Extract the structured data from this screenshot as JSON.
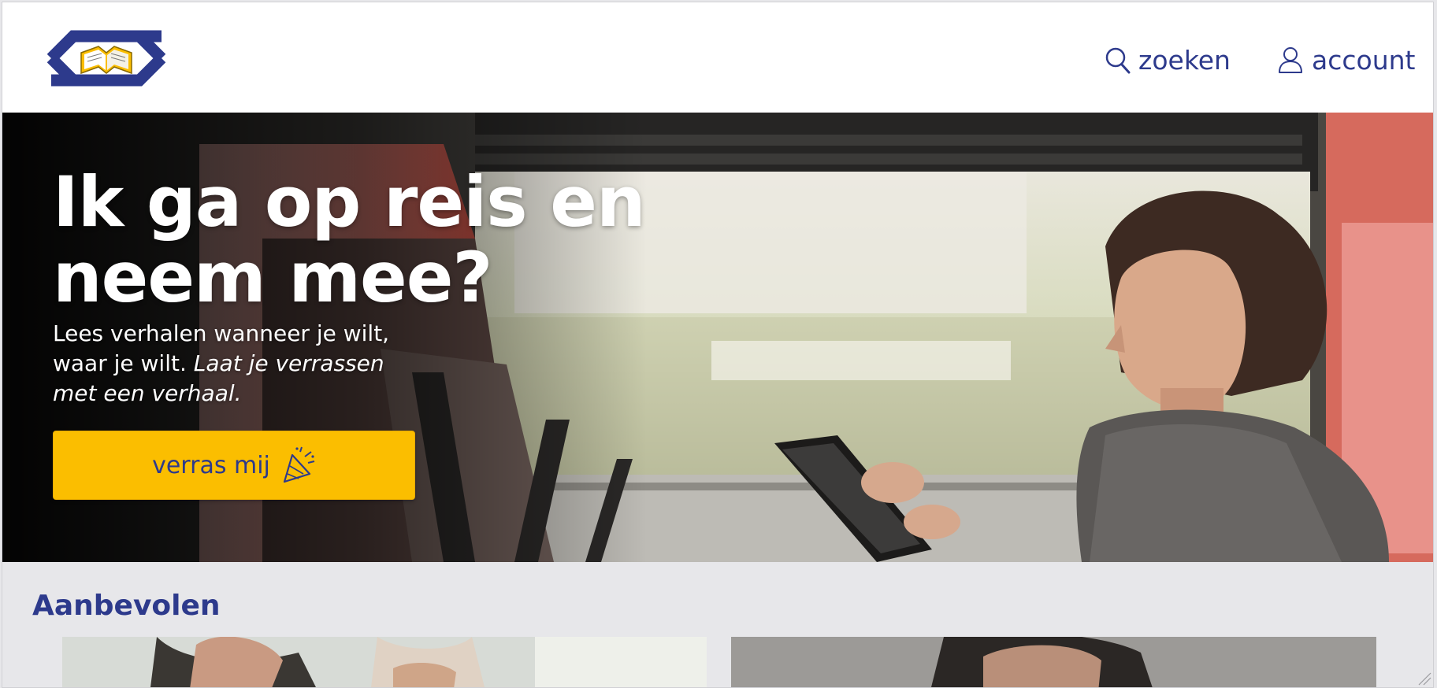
{
  "header": {
    "logo_name": "ns-book-logo",
    "search_label": "zoeken",
    "account_label": "account"
  },
  "hero": {
    "title_line1": "Ik ga op reis en",
    "title_line2": "neem mee?",
    "subtitle_plain": "Lees verhalen wanneer je wilt, waar je wilt.",
    "subtitle_italic": "Laat je verrassen met een verhaal.",
    "cta_label": "verras mij"
  },
  "recommended": {
    "title": "Aanbevolen",
    "cards": [
      "card-1",
      "card-2"
    ]
  },
  "colors": {
    "brand_blue": "#2d3a8c",
    "accent_yellow": "#fbbe00",
    "page_bg": "#e7e7ea"
  },
  "icons": [
    "ns-logo",
    "search-icon",
    "user-icon",
    "party-popper-icon"
  ]
}
